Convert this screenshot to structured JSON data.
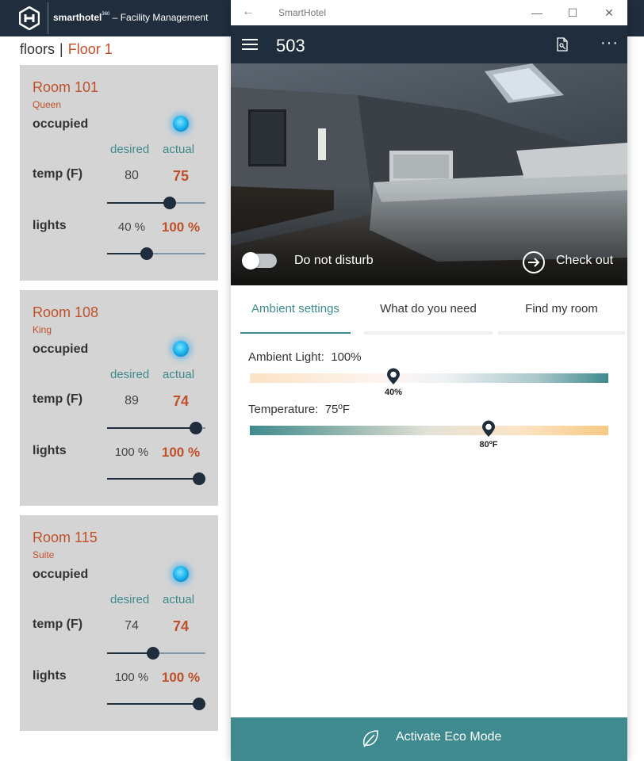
{
  "dashboard": {
    "brand": {
      "name": "smarthotel",
      "sup": "360",
      "suffix": " – Facility Management"
    },
    "breadcrumb": {
      "root": "floors",
      "separator": "|",
      "current": "Floor 1"
    },
    "rooms": [
      {
        "name": "Room 101",
        "type": "Queen",
        "status": "occupied",
        "desired_label": "desired",
        "actual_label": "actual",
        "temp_label": "temp (F)",
        "temp_desired": "80",
        "temp_actual": "75",
        "lights_label": "lights",
        "lights_desired": "40 %",
        "lights_actual": "100 %",
        "temp_slider": 0.64,
        "lights_slider": 0.4
      },
      {
        "name": "Room 108",
        "type": "King",
        "status": "occupied",
        "desired_label": "desired",
        "actual_label": "actual",
        "temp_label": "temp (F)",
        "temp_desired": "89",
        "temp_actual": "74",
        "lights_label": "lights",
        "lights_desired": "100 %",
        "lights_actual": "100 %",
        "temp_slider": 0.9,
        "lights_slider": 1.0
      },
      {
        "name": "Room 115",
        "type": "Suite",
        "status": "occupied",
        "desired_label": "desired",
        "actual_label": "actual",
        "temp_label": "temp (F)",
        "temp_desired": "74",
        "temp_actual": "74",
        "lights_label": "lights",
        "lights_desired": "100 %",
        "lights_actual": "100 %",
        "temp_slider": 0.47,
        "lights_slider": 1.0
      }
    ]
  },
  "window": {
    "title": "SmartHotel",
    "controls": {
      "minimize": "—",
      "maximize": "☐",
      "close": "✕"
    }
  },
  "app": {
    "room_number": "503",
    "hero": {
      "dnd_label": "Do not disturb",
      "dnd_on": false,
      "checkout_label": "Check out"
    },
    "tabs": [
      {
        "label": "Ambient settings",
        "active": true
      },
      {
        "label": "What do you need",
        "active": false
      },
      {
        "label": "Find my room",
        "active": false
      }
    ],
    "ambient_light": {
      "label": "Ambient Light:",
      "value": "100%",
      "pin_label": "40%",
      "pin_fraction": 0.4
    },
    "temperature": {
      "label": "Temperature:",
      "value": "75ºF",
      "pin_label": "80ºF",
      "pin_fraction": 0.667
    },
    "eco_button": "Activate Eco Mode"
  },
  "colors": {
    "navy": "#1f2d3d",
    "teal": "#3f8a8e",
    "accent_orange": "#c0502a",
    "card_bg": "#d4d4d4"
  }
}
